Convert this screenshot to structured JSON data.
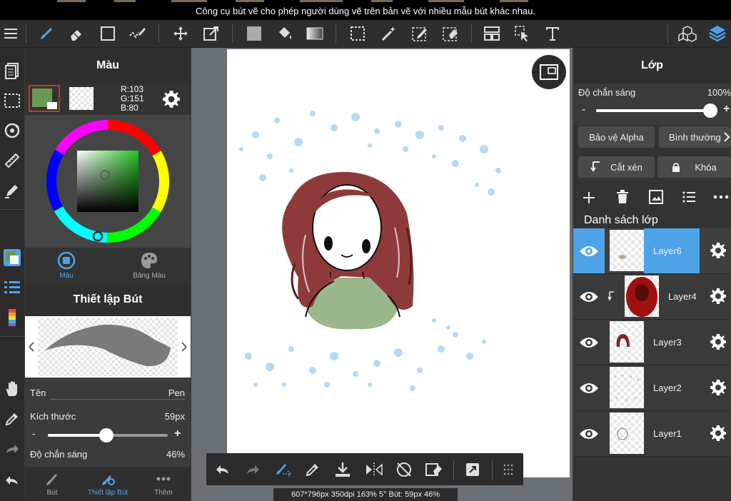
{
  "topbar": {
    "message": "Công cụ bút vẽ cho phép người dùng vẽ trên bản vẽ với nhiều mẫu bút khác nhau."
  },
  "toolbar": {
    "tools": [
      "menu-icon",
      "pen-icon",
      "eraser-icon",
      "square-select-icon",
      "pen-lasso-icon",
      "move-icon",
      "transform-icon",
      "fill-color-icon",
      "bucket-icon",
      "gradient-icon",
      "select-icon",
      "magic-wand-icon",
      "select-pen-icon",
      "select-eraser-icon",
      "layout-icon",
      "operation-icon",
      "text-icon",
      "3d-icon",
      "layers-icon"
    ],
    "accent": "#4ea3e8"
  },
  "color_panel": {
    "title": "Màu",
    "main_color": "#6a9a52",
    "rgb_r": "R:103",
    "rgb_g": "G:151",
    "rgb_b": "B:80",
    "tabs": [
      {
        "label": "Màu"
      },
      {
        "label": "Bảng Màu"
      }
    ]
  },
  "brush_panel": {
    "title": "Thiết lập Bút",
    "name_label": "Tên",
    "name_value": "Pen",
    "size_label": "Kích thước",
    "size_value": "59px",
    "size_fraction": 0.49,
    "opacity_label": "Độ chắn sáng",
    "opacity_value": "46%",
    "minus": "-",
    "plus": "+",
    "tabs": [
      {
        "label": "Bút"
      },
      {
        "label": "Thiết lập Bút"
      },
      {
        "label": "Thêm"
      }
    ]
  },
  "layer_panel": {
    "title": "Lớp",
    "opacity_label": "Độ chắn sáng",
    "opacity_value": "100%",
    "opacity_fraction": 1.0,
    "minus": "-",
    "plus": "+",
    "alpha_protect": "Bảo vệ Alpha",
    "blend_mode": "Bình thường",
    "clip_label": "Cắt xén",
    "lock_label": "Khóa",
    "list_title": "Danh sách lớp",
    "layers": [
      {
        "name": "Layer6",
        "selected": true
      },
      {
        "name": "Layer4",
        "selected": false
      },
      {
        "name": "Layer3",
        "selected": false
      },
      {
        "name": "Layer2",
        "selected": false
      },
      {
        "name": "Layer1",
        "selected": false
      }
    ]
  },
  "status": {
    "text": "607*796px 350dpi 163% 5° Bút: 59px 46%"
  }
}
